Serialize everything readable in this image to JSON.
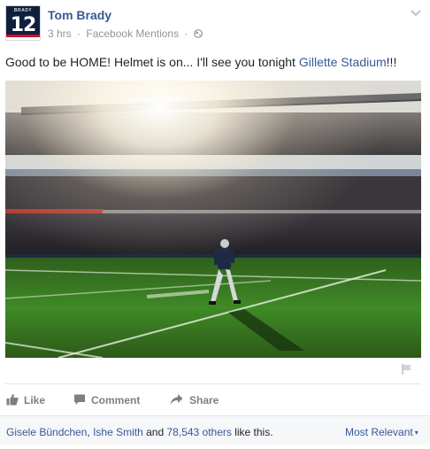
{
  "post": {
    "author": "Tom Brady",
    "avatar": {
      "strip_text": "BRADY",
      "number": "12"
    },
    "timestamp": "3 hrs",
    "separator": "·",
    "source": "Facebook Mentions",
    "message": {
      "text_before": "Good to be HOME! Helmet is on... I'll see you tonight ",
      "link_text": "Gillette Stadium",
      "text_after": "!!!"
    }
  },
  "actions": {
    "like": "Like",
    "comment": "Comment",
    "share": "Share"
  },
  "likes": {
    "person1": "Gisele Bündchen",
    "comma": ", ",
    "person2": "Ishe Smith",
    "and": " and ",
    "others": "78,543 others",
    "suffix": " like this."
  },
  "comments_sort": {
    "label": "Most Relevant",
    "caret": "▾"
  },
  "colors": {
    "link": "#365899",
    "meta": "#90949c",
    "action": "#7f7f7f",
    "likes_bar_bg": "#f6f7f9",
    "field_green": "#3a7a23"
  },
  "icons": [
    "globe-icon",
    "chevron-down-icon",
    "flag-icon",
    "like-icon",
    "comment-icon",
    "share-icon"
  ]
}
